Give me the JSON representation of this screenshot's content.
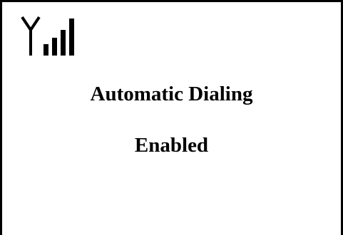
{
  "status": {
    "signal_icon": "signal-strength-icon",
    "signal_bars": 4
  },
  "message": {
    "line1": "Automatic Dialing",
    "line2": "Enabled"
  },
  "colors": {
    "background": "#ffffff",
    "foreground": "#000000"
  }
}
